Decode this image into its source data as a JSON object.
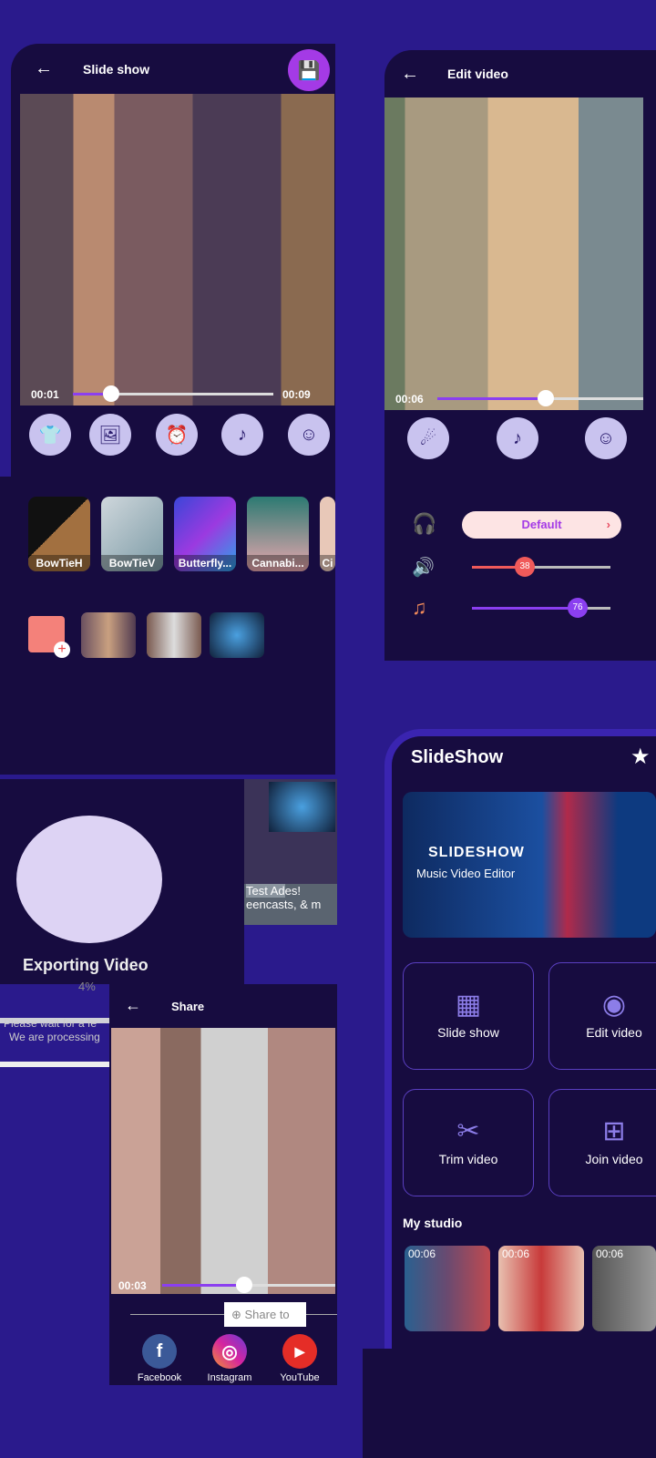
{
  "slideshow_editor": {
    "title": "Slide show",
    "current_time": "00:01",
    "end_time": "00:09",
    "progress": 0.11,
    "tools": [
      "shirt-icon",
      "images-icon",
      "alarm-clock-icon",
      "music-folder-icon",
      "emoji-icon"
    ],
    "effects": [
      {
        "label": "BowTieH"
      },
      {
        "label": "BowTieV"
      },
      {
        "label": "Butterfly..."
      },
      {
        "label": "Cannabi..."
      },
      {
        "label": "Ci"
      }
    ],
    "photos_count_visible": 4
  },
  "export": {
    "title": "Exporting Video",
    "percent": "4%",
    "progress": 0.04,
    "line1": "Please wait for a fe",
    "line2": "We are processing"
  },
  "ad": {
    "label": "Test Ad",
    "line1": "es!",
    "line2": "eencasts, & m"
  },
  "share": {
    "title": "Share",
    "current_time": "00:03",
    "progress": 0.4,
    "share_to": "Share to",
    "targets": [
      {
        "label": "Facebook",
        "color": "#3b5998",
        "glyph": "f"
      },
      {
        "label": "Instagram",
        "color": "#d6249f",
        "glyph": "◎"
      },
      {
        "label": "YouTube",
        "color": "#e52d27",
        "glyph": "▶"
      }
    ]
  },
  "edit_video": {
    "title": "Edit video",
    "current_time": "00:06",
    "progress": 0.6,
    "tools": [
      "magic-star-icon",
      "music-folder-icon",
      "emoji-icon"
    ],
    "audio_preset": "Default",
    "volume": 38,
    "music_volume": 76
  },
  "home": {
    "title": "SlideShow",
    "banner_title": "SLIDESHOW",
    "banner_subtitle": "Music Video Editor",
    "cards": [
      {
        "label": "Slide show"
      },
      {
        "label": "Edit video"
      },
      {
        "label": "Trim video"
      },
      {
        "label": "Join video"
      }
    ],
    "studio_title": "My studio",
    "studio": [
      {
        "duration": "00:06"
      },
      {
        "duration": "00:06"
      },
      {
        "duration": "00:06"
      }
    ]
  },
  "colors": {
    "accent": "#8b3ff0",
    "background": "#2a1a8c",
    "panel": "#170c40"
  }
}
